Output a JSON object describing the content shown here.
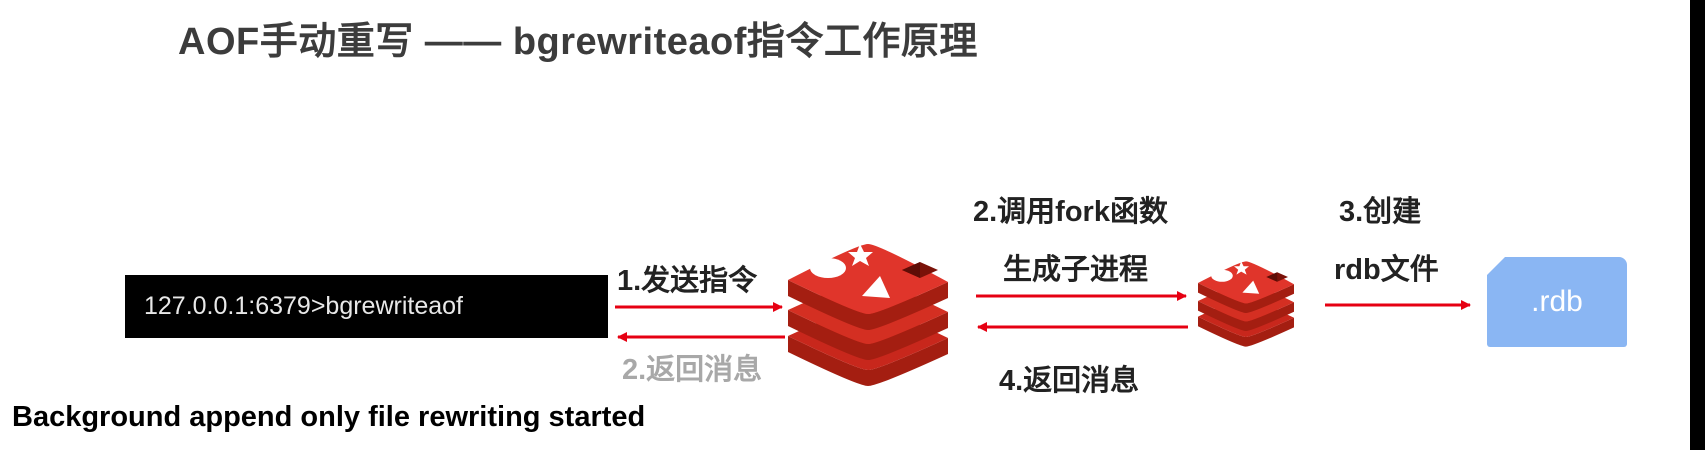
{
  "title": "AOF手动重写 —— bgrewriteaof指令工作原理",
  "terminal": {
    "command": "127.0.0.1:6379>bgrewriteaof"
  },
  "steps": {
    "send_command": "1.发送指令",
    "return_message_client": "2.返回消息",
    "fork_line1": "2.调用fork函数",
    "fork_line2": "生成子进程",
    "create_line1": "3.创建",
    "create_line2": "rdb文件",
    "return_message_child": "4.返回消息"
  },
  "rdb_file": {
    "label": ".rdb"
  },
  "result_message": "Background append only file rewriting started",
  "colors": {
    "arrow": "#e60012",
    "redis_top": "#e0352b",
    "redis_side": "#a41e11",
    "redis_layer": "#c8271c",
    "rdb_fill": "#8ab6f3",
    "muted_text": "#a8a8a8"
  }
}
